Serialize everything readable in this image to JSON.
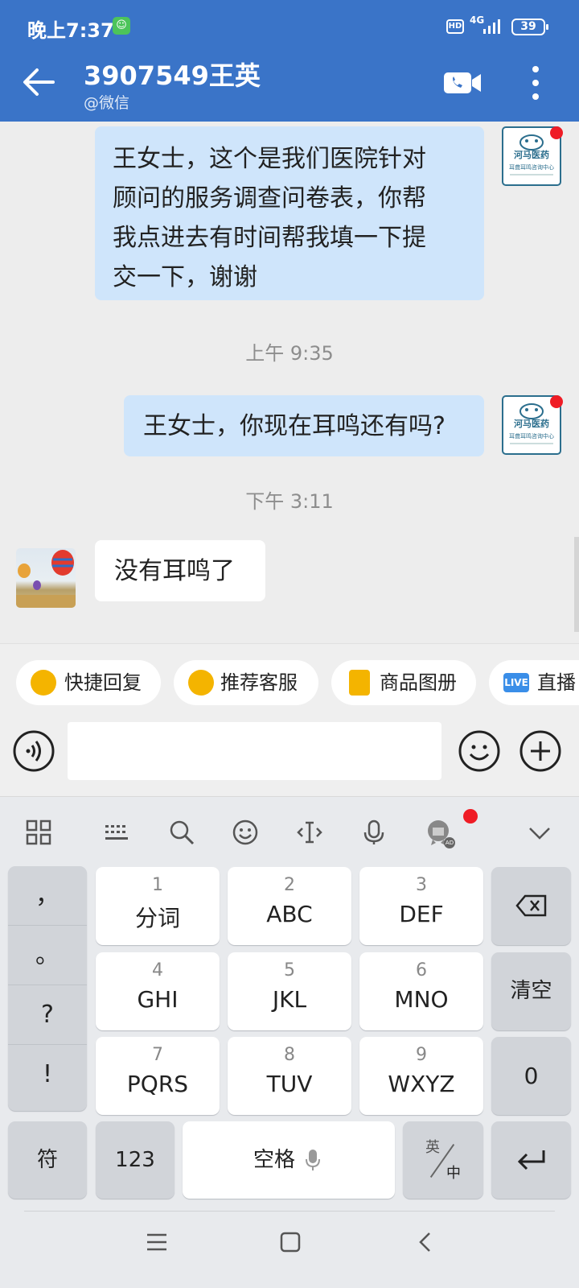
{
  "status": {
    "time": "晚上7:37",
    "badge": "☺",
    "hd": "HD",
    "network": "4G",
    "battery": "39"
  },
  "header": {
    "title": "3907549王英",
    "subtitle": "@微信"
  },
  "shop_logo": {
    "name": "河马医药",
    "subtitle": "耳聋耳鸣咨询中心"
  },
  "messages": [
    {
      "side": "right",
      "text_lines": [
        "王女士，这个是我们医院针对",
        "顾问的服务调查问卷表，你帮",
        "我点进去有时间帮我填一下提",
        "交一下，谢谢"
      ]
    },
    {
      "timestamp": "上午 9:35"
    },
    {
      "side": "right",
      "text_lines": [
        "王女士，你现在耳鸣还有吗?"
      ]
    },
    {
      "timestamp": "下午 3:11"
    },
    {
      "side": "left",
      "text_lines": [
        "没有耳鸣了"
      ]
    }
  ],
  "quick": [
    {
      "label": "快捷回复"
    },
    {
      "label": "推荐客服"
    },
    {
      "label": "商品图册"
    },
    {
      "label": "直播",
      "badge": "LIVE"
    }
  ],
  "keyboard": {
    "side": [
      "，",
      "。",
      "?",
      "!"
    ],
    "keys": [
      {
        "n": "1",
        "l": "分词"
      },
      {
        "n": "2",
        "l": "ABC"
      },
      {
        "n": "3",
        "l": "DEF"
      },
      {
        "n": "4",
        "l": "GHI"
      },
      {
        "n": "5",
        "l": "JKL"
      },
      {
        "n": "6",
        "l": "MNO"
      },
      {
        "n": "7",
        "l": "PQRS"
      },
      {
        "n": "8",
        "l": "TUV"
      },
      {
        "n": "9",
        "l": "WXYZ"
      }
    ],
    "clear": "清空",
    "zero": "0",
    "symbol": "符",
    "num": "123",
    "space": "空格",
    "lang_top": "英",
    "lang_bottom": "中",
    "ad": "AD"
  }
}
